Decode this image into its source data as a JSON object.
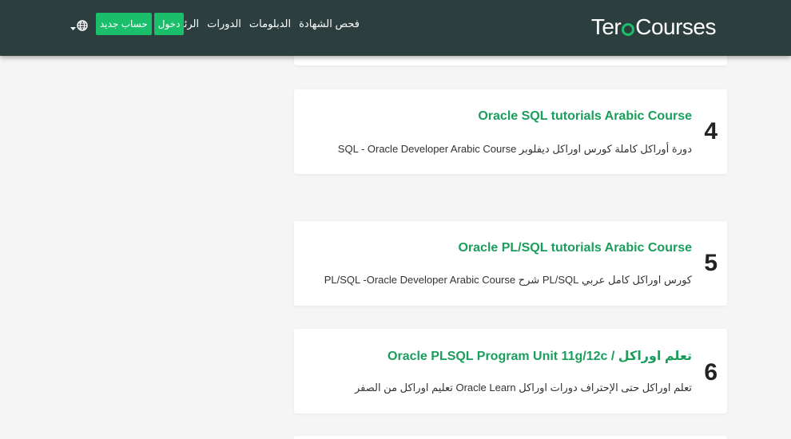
{
  "header": {
    "logo_part1": "Ter",
    "logo_part2": "Courses",
    "nav": [
      "الرئيسية",
      "الدورات",
      "الدبلومات",
      "فحص الشهادة"
    ],
    "login_label": "دخول",
    "register_label": "حساب جديد"
  },
  "colors": {
    "header_bg": "#2c3e3e",
    "accent": "#1bbf6b",
    "title_green": "#1a9e5c",
    "page_bg": "#f5f5f5"
  },
  "courses": [
    {
      "number": "4",
      "title": "Oracle SQL tutorials Arabic Course",
      "description": "دورة أوراكل كاملة كورس اوراكل ديفلوبر SQL - Oracle Developer Arabic Course"
    },
    {
      "number": "5",
      "title": "Oracle PL/SQL tutorials Arabic Course",
      "description": "كورس اوراكل كامل عربي PL/SQL شرح PL/SQL -Oracle Developer Arabic Course"
    },
    {
      "number": "6",
      "title": "تعلم اوراكل / Oracle PLSQL Program Unit 11g/12c",
      "description": "تعلم اوراكل حتى الإحتراف دورات اوراكل Oracle Learn تعليم اوراكل من الصفر"
    }
  ]
}
